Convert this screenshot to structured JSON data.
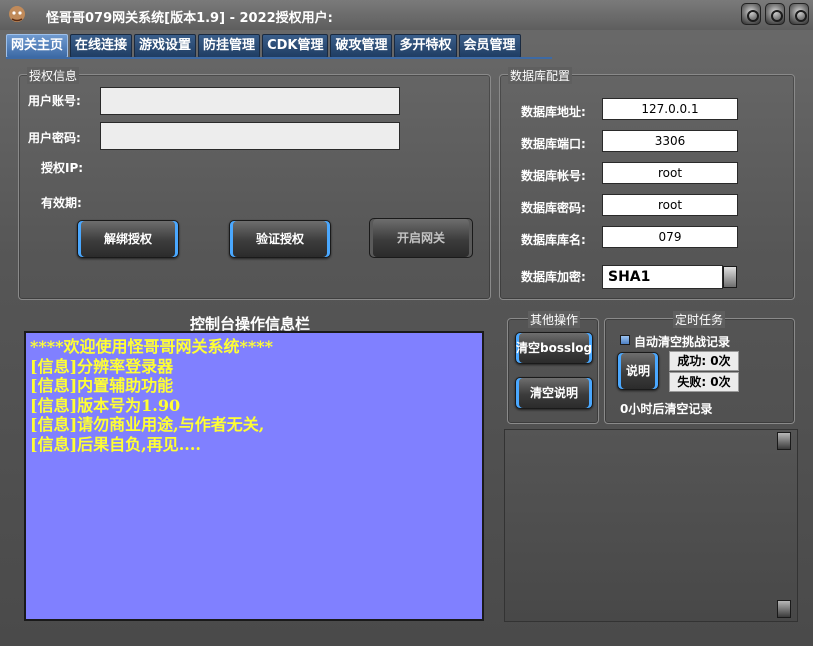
{
  "window": {
    "title": "怪哥哥079网关系统[版本1.9] - 2022授权用户:",
    "icon": "mascot-icon"
  },
  "tabs": [
    {
      "label": "网关主页",
      "active": true
    },
    {
      "label": "在线连接",
      "active": false
    },
    {
      "label": "游戏设置",
      "active": false
    },
    {
      "label": "防挂管理",
      "active": false
    },
    {
      "label": "CDK管理",
      "active": false
    },
    {
      "label": "破攻管理",
      "active": false
    },
    {
      "label": "多开特权",
      "active": false
    },
    {
      "label": "会员管理",
      "active": false
    }
  ],
  "auth": {
    "group_title": "授权信息",
    "account_label": "用户账号:",
    "account_value": "",
    "password_label": "用户密码:",
    "password_value": "",
    "ip_label": "授权IP:",
    "expiry_label": "有效期:",
    "unbind_button": "解绑授权",
    "verify_button": "验证授权",
    "open_gateway_button": "开启网关"
  },
  "database": {
    "group_title": "数据库配置",
    "address_label": "数据库地址:",
    "address_value": "127.0.0.1",
    "port_label": "数据库端口:",
    "port_value": "3306",
    "account_label": "数据库帐号:",
    "account_value": "root",
    "password_label": "数据库密码:",
    "password_value": "root",
    "name_label": "数据库库名:",
    "name_value": "079",
    "encrypt_label": "数据库加密:",
    "encrypt_value": "SHA1"
  },
  "console": {
    "title": "控制台操作信息栏",
    "lines": [
      "****欢迎使用怪哥哥网关系统****",
      "[信息]分辨率登录器",
      "[信息]内置辅助功能",
      "[信息]版本号为1.90",
      "[信息]请勿商业用途,与作者无关,",
      "[信息]后果自负,再见...."
    ],
    "background_color": "#8080ff",
    "text_color": "#ffff33"
  },
  "other_ops": {
    "group_title": "其他操作",
    "clear_bosslog_button": "清空bosslog",
    "clear_help_button": "清空说明"
  },
  "timer": {
    "group_title": "定时任务",
    "auto_clear_label": "自动清空挑战记录",
    "auto_clear_checked": false,
    "explain_button": "说明",
    "success_text": "成功: 0次",
    "fail_text": "失败: 0次",
    "countdown_text": "0小时后清空记录"
  },
  "colors": {
    "tab_active": "#3d6aa5",
    "button_glow": "#4aa8ff",
    "background": "#565656"
  }
}
